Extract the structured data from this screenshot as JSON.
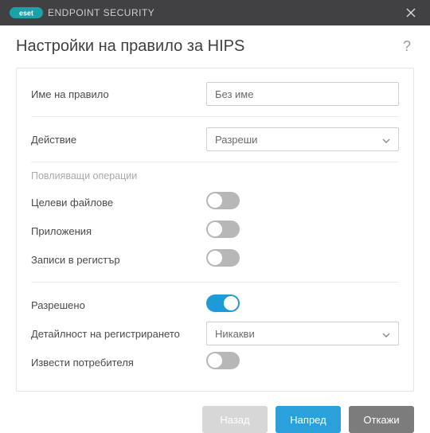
{
  "titlebar": {
    "brand_suffix": "ENDPOINT SECURITY"
  },
  "header": {
    "title": "Настройки на правило за HIPS"
  },
  "fields": {
    "rule_name_label": "Име на правило",
    "rule_name_value": "Без име",
    "action_label": "Действие",
    "action_value": "Разреши",
    "affecting_ops": "Повлияващи операции",
    "target_files": "Целеви файлове",
    "applications": "Приложения",
    "registry_entries": "Записи в регистър",
    "enabled": "Разрешено",
    "logging_detail_label": "Детайлност на регистрирането",
    "logging_detail_value": "Никакви",
    "notify_user": "Извести потребителя"
  },
  "toggles": {
    "target_files": false,
    "applications": false,
    "registry_entries": false,
    "enabled": true,
    "notify_user": false
  },
  "footer": {
    "back": "Назад",
    "next": "Напред",
    "cancel": "Откажи"
  }
}
